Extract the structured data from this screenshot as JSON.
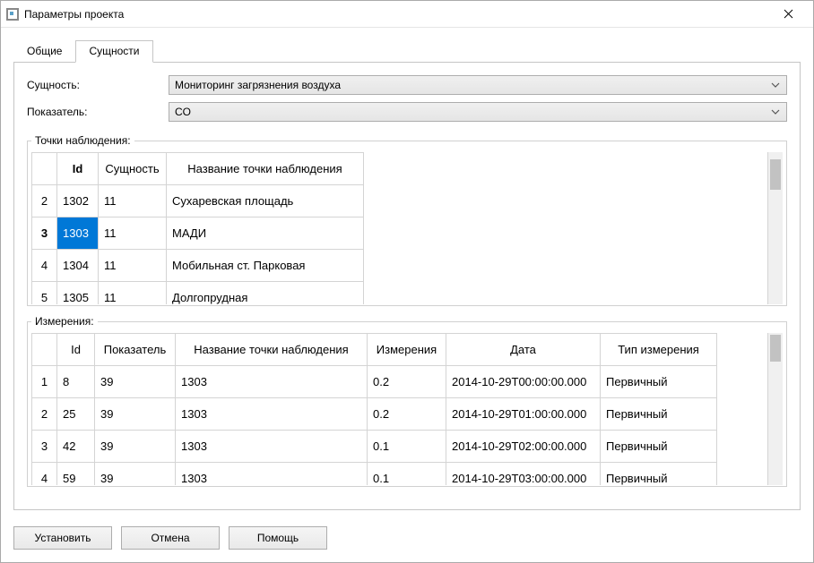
{
  "window": {
    "title": "Параметры проекта"
  },
  "tabs": {
    "general": "Общие",
    "entities": "Сущности"
  },
  "form": {
    "entity_label": "Сущность:",
    "entity_value": "Мониторинг загрязнения воздуха",
    "measure_label": "Показатель:",
    "measure_value": "CO"
  },
  "points": {
    "legend": "Точки наблюдения:",
    "cols": {
      "id": "Id",
      "entity": "Сущность",
      "name": "Название точки наблюдения"
    },
    "rows": [
      {
        "n": "2",
        "id": "1302",
        "entity": "11",
        "name": "Сухаревская площадь"
      },
      {
        "n": "3",
        "id": "1303",
        "entity": "11",
        "name": "МАДИ"
      },
      {
        "n": "4",
        "id": "1304",
        "entity": "11",
        "name": "Мобильная ст. Парковая"
      },
      {
        "n": "5",
        "id": "1305",
        "entity": "11",
        "name": "Долгопрудная"
      }
    ],
    "selected_row_index": 1
  },
  "meas": {
    "legend": "Измерения:",
    "cols": {
      "id": "Id",
      "indicator": "Показатель",
      "point": "Название точки наблюдения",
      "value": "Измерения",
      "date": "Дата",
      "type": "Тип измерения"
    },
    "rows": [
      {
        "n": "1",
        "id": "8",
        "indicator": "39",
        "point": "1303",
        "value": "0.2",
        "date": "2014-10-29T00:00:00.000",
        "type": "Первичный"
      },
      {
        "n": "2",
        "id": "25",
        "indicator": "39",
        "point": "1303",
        "value": "0.2",
        "date": "2014-10-29T01:00:00.000",
        "type": "Первичный"
      },
      {
        "n": "3",
        "id": "42",
        "indicator": "39",
        "point": "1303",
        "value": "0.1",
        "date": "2014-10-29T02:00:00.000",
        "type": "Первичный"
      },
      {
        "n": "4",
        "id": "59",
        "indicator": "39",
        "point": "1303",
        "value": "0.1",
        "date": "2014-10-29T03:00:00.000",
        "type": "Первичный"
      }
    ]
  },
  "buttons": {
    "apply": "Установить",
    "cancel": "Отмена",
    "help": "Помощь"
  }
}
